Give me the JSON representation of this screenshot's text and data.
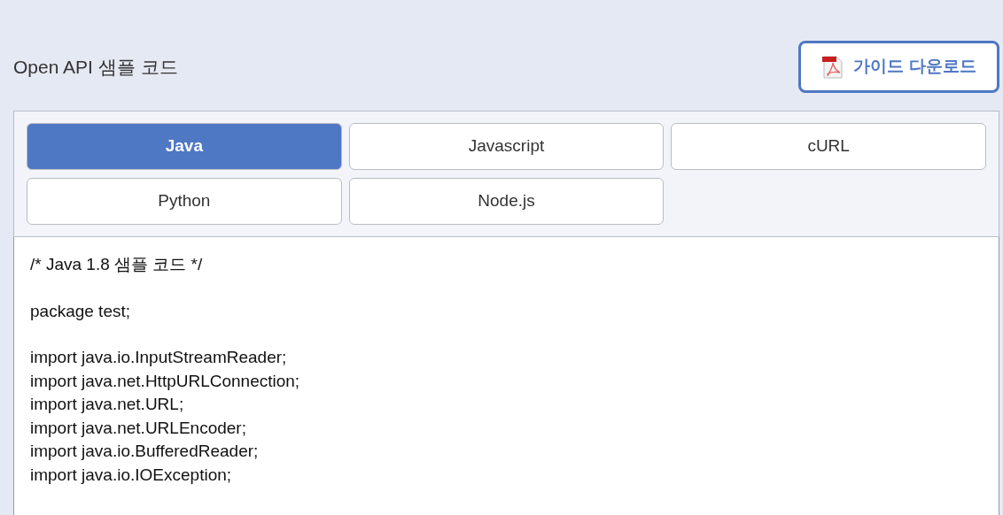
{
  "title": "Open API 샘플 코드",
  "guide_button": {
    "label": "가이드 다운로드"
  },
  "tabs": [
    {
      "label": "Java",
      "selected": true
    },
    {
      "label": "Javascript",
      "selected": false
    },
    {
      "label": "cURL",
      "selected": false
    },
    {
      "label": "Python",
      "selected": false
    },
    {
      "label": "Node.js",
      "selected": false
    }
  ],
  "code_blocks": [
    [
      "/* Java 1.8 샘플 코드 */"
    ],
    [
      "package test;"
    ],
    [
      "import java.io.InputStreamReader;",
      "import java.net.HttpURLConnection;",
      "import java.net.URL;",
      "import java.net.URLEncoder;",
      "import java.io.BufferedReader;",
      "import java.io.IOException;"
    ]
  ]
}
